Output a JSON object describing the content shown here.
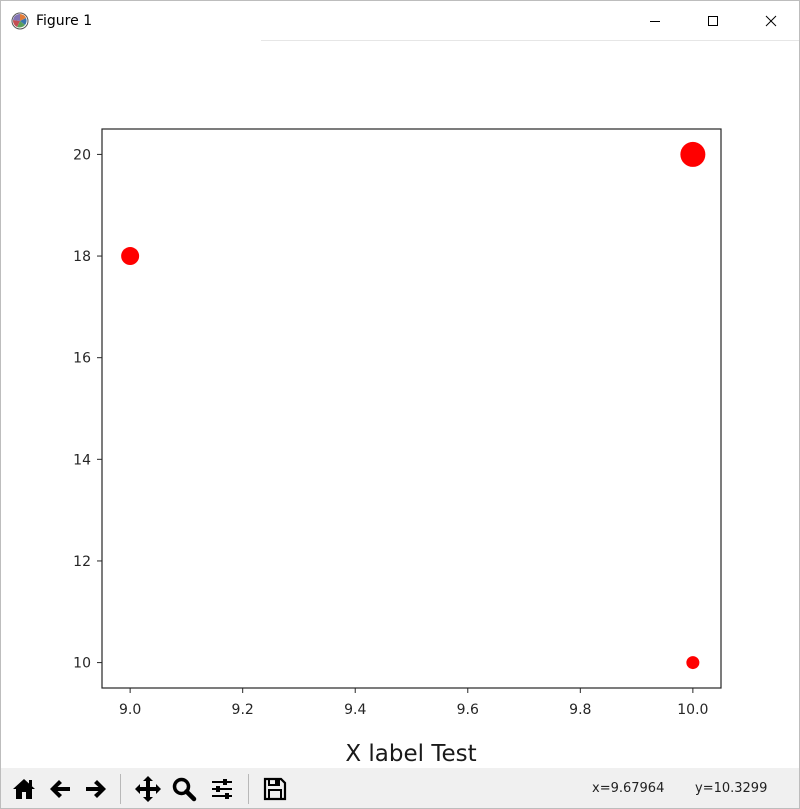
{
  "window": {
    "title": "Figure 1"
  },
  "toolbar": {
    "buttons": [
      {
        "name": "home-icon"
      },
      {
        "name": "back-arrow-icon"
      },
      {
        "name": "forward-arrow-icon"
      },
      {
        "name": "pan-icon"
      },
      {
        "name": "zoom-icon"
      },
      {
        "name": "configure-subplots-icon"
      },
      {
        "name": "save-icon"
      }
    ],
    "x_readout": "x=9.67964",
    "y_readout": "y=10.3299"
  },
  "chart_data": {
    "type": "scatter",
    "title": "",
    "xlabel": "X label Test",
    "ylabel": "",
    "xlim": [
      8.95,
      10.05
    ],
    "ylim": [
      9.5,
      20.5
    ],
    "xticks": [
      9.0,
      9.2,
      9.4,
      9.6,
      9.8,
      10.0
    ],
    "xtick_labels": [
      "9.0",
      "9.2",
      "9.4",
      "9.6",
      "9.8",
      "10.0"
    ],
    "yticks": [
      10,
      12,
      14,
      16,
      18,
      20
    ],
    "ytick_labels": [
      "10",
      "12",
      "14",
      "16",
      "18",
      "20"
    ],
    "grid": false,
    "points": [
      {
        "x": 9.0,
        "y": 18,
        "size": 2
      },
      {
        "x": 10.0,
        "y": 20,
        "size": 3
      },
      {
        "x": 10.0,
        "y": 10,
        "size": 1
      }
    ],
    "color": "#ff0000"
  }
}
